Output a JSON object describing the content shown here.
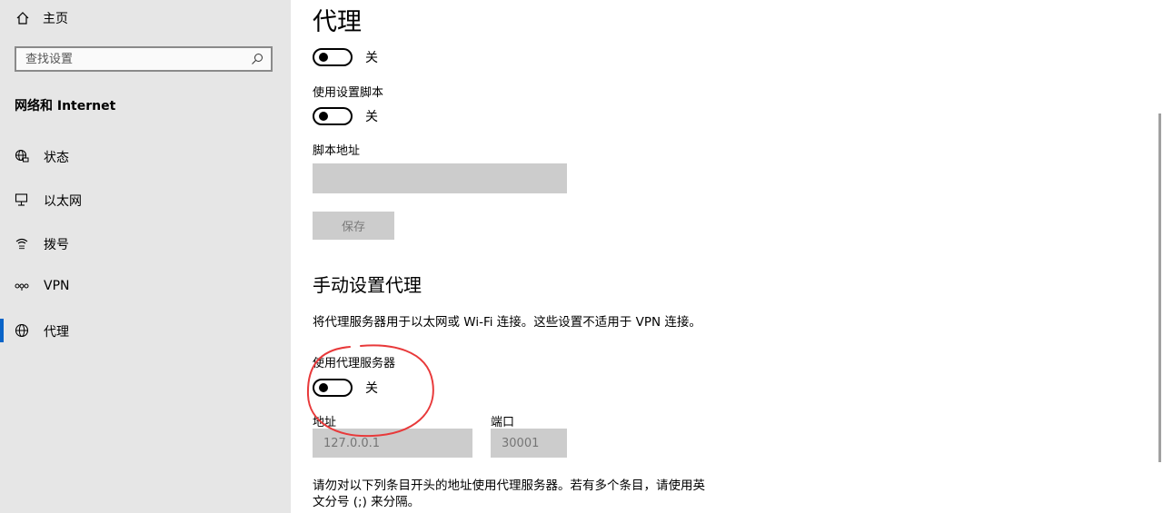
{
  "sidebar": {
    "home_label": "主页",
    "search_placeholder": "查找设置",
    "section_title": "网络和 Internet",
    "items": [
      {
        "label": "状态",
        "icon": "globe-status-icon",
        "active": false
      },
      {
        "label": "以太网",
        "icon": "ethernet-icon",
        "active": false
      },
      {
        "label": "拨号",
        "icon": "dialup-icon",
        "active": false
      },
      {
        "label": "VPN",
        "icon": "vpn-icon",
        "active": false
      },
      {
        "label": "代理",
        "icon": "globe-icon",
        "active": true
      }
    ],
    "accent_color": "#0a64c8"
  },
  "main": {
    "title": "代理",
    "auto_detect_state": "关",
    "use_script_label": "使用设置脚本",
    "use_script_state": "关",
    "script_address_label": "脚本地址",
    "script_address_value": "",
    "save_label": "保存",
    "manual_title": "手动设置代理",
    "manual_desc": "将代理服务器用于以太网或 Wi-Fi 连接。这些设置不适用于 VPN 连接。",
    "use_proxy_label": "使用代理服务器",
    "use_proxy_state": "关",
    "address_label": "地址",
    "address_placeholder": "127.0.0.1",
    "port_label": "端口",
    "port_placeholder": "30001",
    "exceptions_desc_line1": "请勿对以下列条目开头的地址使用代理服务器。若有多个条目，请使用英",
    "exceptions_desc_line2": "文分号 (;) 来分隔。"
  },
  "annotation_color": "#e8393a"
}
